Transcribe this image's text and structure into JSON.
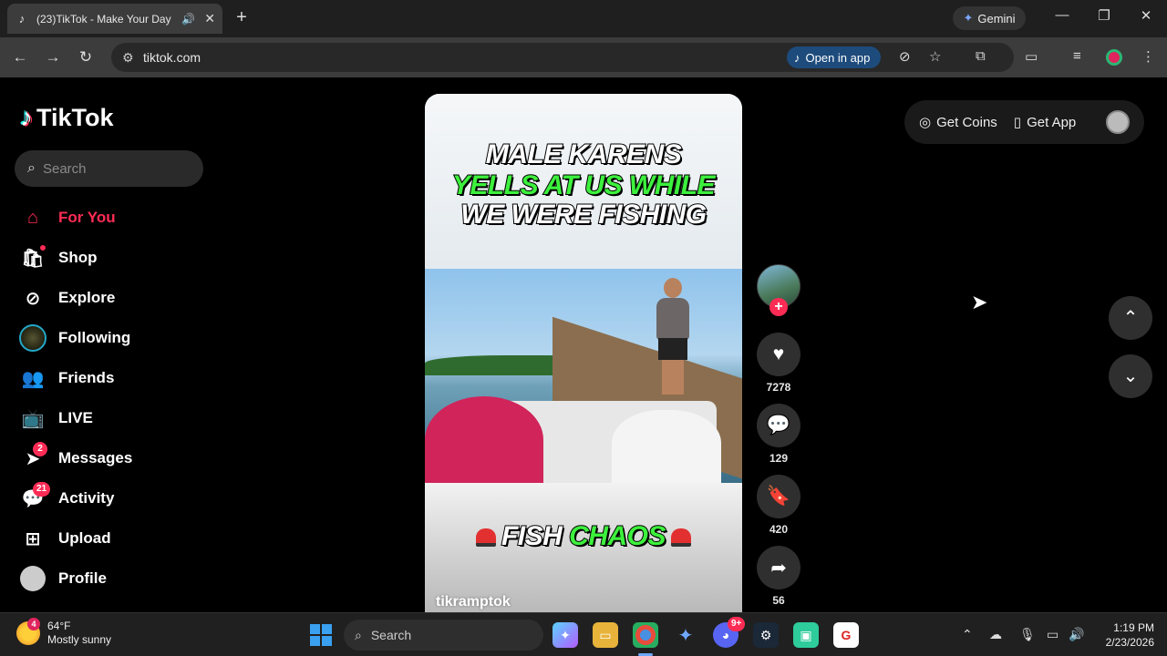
{
  "browser": {
    "tab_title": "(23)TikTok - Make Your Day",
    "new_tab_symbol": "+",
    "gemini_label": "Gemini",
    "url": "tiktok.com",
    "open_in_app_label": "Open in app"
  },
  "tiktok": {
    "logo_text": "TikTok",
    "search_placeholder": "Search",
    "nav": [
      {
        "label": "For You",
        "icon": "home-icon",
        "active": true
      },
      {
        "label": "Shop",
        "icon": "shop-icon"
      },
      {
        "label": "Explore",
        "icon": "compass-icon"
      },
      {
        "label": "Following",
        "icon": "following-avatar"
      },
      {
        "label": "Friends",
        "icon": "friends-icon"
      },
      {
        "label": "LIVE",
        "icon": "live-icon"
      },
      {
        "label": "Messages",
        "icon": "messages-icon",
        "badge": "2"
      },
      {
        "label": "Activity",
        "icon": "activity-icon",
        "badge": "21"
      },
      {
        "label": "Upload",
        "icon": "upload-icon"
      },
      {
        "label": "Profile",
        "icon": "profile-avatar"
      }
    ],
    "top_right": {
      "get_coins": "Get Coins",
      "get_app": "Get App"
    },
    "video": {
      "caption_line1": "MALE KARENS",
      "caption_line2": "YELLS AT US WHILE",
      "caption_line3": "WE WERE FISHING",
      "bottom_word1": "FISH",
      "bottom_word2": "CHAOS",
      "author": "tikramptok"
    },
    "actions": {
      "likes": "7278",
      "comments": "129",
      "saves": "420",
      "shares": "56"
    }
  },
  "taskbar": {
    "weather_badge": "4",
    "temperature": "64°F",
    "condition": "Mostly sunny",
    "search_label": "Search",
    "discord_badge": "9+",
    "time": "1:19 PM",
    "date": "2/23/2026"
  },
  "colors": {
    "accent": "#fe2c55",
    "caption_green": "#3df03d",
    "open_in_app_bg": "#1d4b7c"
  }
}
